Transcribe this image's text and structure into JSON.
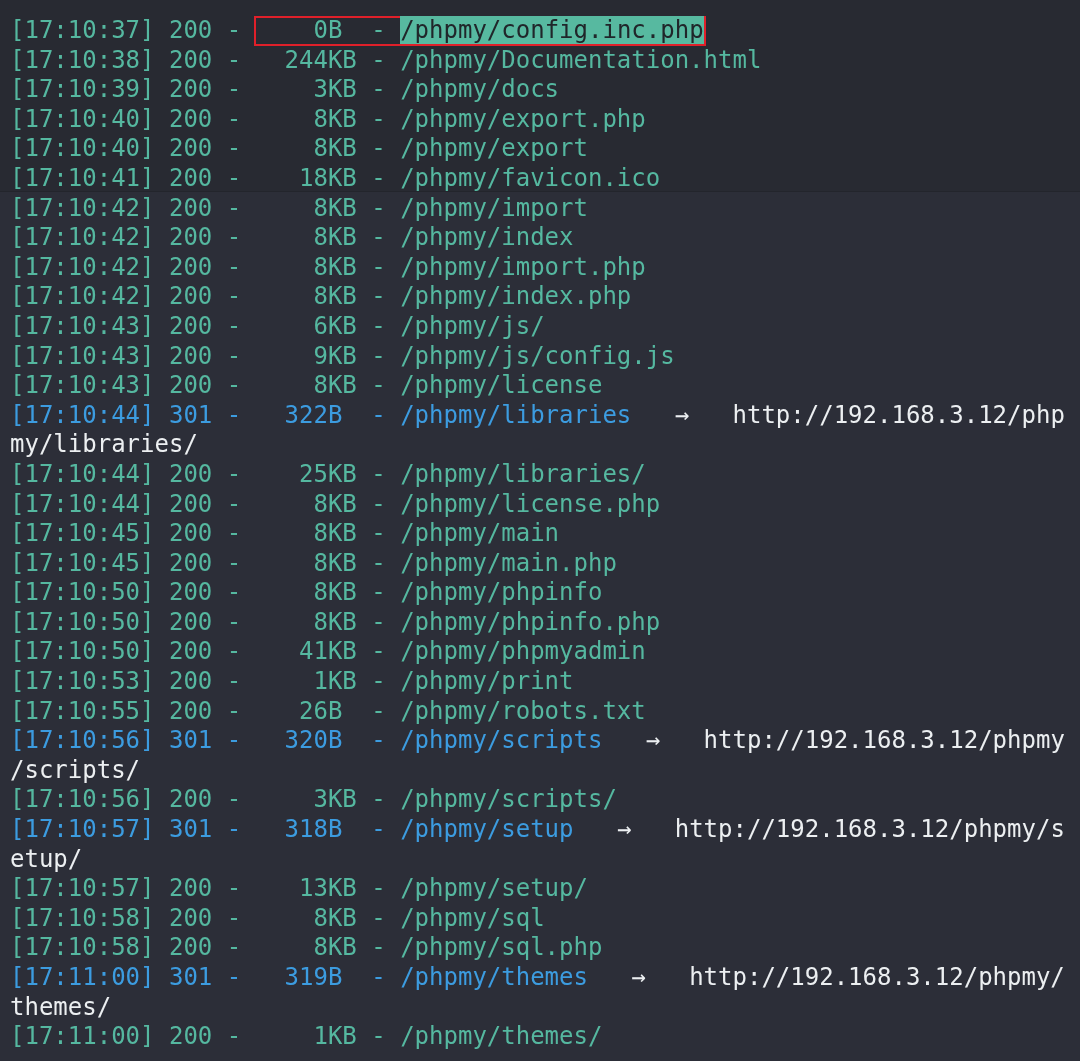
{
  "terminal": {
    "lines": [
      {
        "kind": "ok",
        "text": "[17:10:37] 200 - ",
        "marked": {
          "text": "    0B  - ",
          "selection": "/phpmy/config.inc.php"
        }
      },
      {
        "kind": "ok",
        "text": "[17:10:38] 200 -   244KB - /phpmy/Documentation.html"
      },
      {
        "kind": "ok",
        "text": "[17:10:39] 200 -     3KB - /phpmy/docs"
      },
      {
        "kind": "ok",
        "text": "[17:10:40] 200 -     8KB - /phpmy/export.php"
      },
      {
        "kind": "ok",
        "text": "[17:10:40] 200 -     8KB - /phpmy/export"
      },
      {
        "kind": "ok",
        "text": "[17:10:41] 200 -    18KB - /phpmy/favicon.ico"
      },
      {
        "kind": "ok",
        "text": "[17:10:42] 200 -     8KB - /phpmy/import"
      },
      {
        "kind": "ok",
        "text": "[17:10:42] 200 -     8KB - /phpmy/index"
      },
      {
        "kind": "ok",
        "text": "[17:10:42] 200 -     8KB - /phpmy/import.php"
      },
      {
        "kind": "ok",
        "text": "[17:10:42] 200 -     8KB - /phpmy/index.php"
      },
      {
        "kind": "ok",
        "text": "[17:10:43] 200 -     6KB - /phpmy/js/"
      },
      {
        "kind": "ok",
        "text": "[17:10:43] 200 -     9KB - /phpmy/js/config.js"
      },
      {
        "kind": "ok",
        "text": "[17:10:43] 200 -     8KB - /phpmy/license"
      },
      {
        "kind": "redirect",
        "text": "[17:10:44] 301 -   322B  - /phpmy/libraries",
        "arrow": "→",
        "url": "http://192.168.3.12/php"
      },
      {
        "kind": "wrap",
        "text": "my/libraries/"
      },
      {
        "kind": "ok",
        "text": "[17:10:44] 200 -    25KB - /phpmy/libraries/"
      },
      {
        "kind": "ok",
        "text": "[17:10:44] 200 -     8KB - /phpmy/license.php"
      },
      {
        "kind": "ok",
        "text": "[17:10:45] 200 -     8KB - /phpmy/main"
      },
      {
        "kind": "ok",
        "text": "[17:10:45] 200 -     8KB - /phpmy/main.php"
      },
      {
        "kind": "ok",
        "text": "[17:10:50] 200 -     8KB - /phpmy/phpinfo"
      },
      {
        "kind": "ok",
        "text": "[17:10:50] 200 -     8KB - /phpmy/phpinfo.php"
      },
      {
        "kind": "ok",
        "text": "[17:10:50] 200 -    41KB - /phpmy/phpmyadmin"
      },
      {
        "kind": "ok",
        "text": "[17:10:53] 200 -     1KB - /phpmy/print"
      },
      {
        "kind": "ok",
        "text": "[17:10:55] 200 -    26B  - /phpmy/robots.txt"
      },
      {
        "kind": "redirect",
        "text": "[17:10:56] 301 -   320B  - /phpmy/scripts",
        "arrow": "→",
        "url": "http://192.168.3.12/phpmy"
      },
      {
        "kind": "wrap",
        "text": "/scripts/"
      },
      {
        "kind": "ok",
        "text": "[17:10:56] 200 -     3KB - /phpmy/scripts/"
      },
      {
        "kind": "redirect",
        "text": "[17:10:57] 301 -   318B  - /phpmy/setup",
        "arrow": "→",
        "url": "http://192.168.3.12/phpmy/s"
      },
      {
        "kind": "wrap",
        "text": "etup/"
      },
      {
        "kind": "ok",
        "text": "[17:10:57] 200 -    13KB - /phpmy/setup/"
      },
      {
        "kind": "ok",
        "text": "[17:10:58] 200 -     8KB - /phpmy/sql"
      },
      {
        "kind": "ok",
        "text": "[17:10:58] 200 -     8KB - /phpmy/sql.php"
      },
      {
        "kind": "redirect",
        "text": "[17:11:00] 301 -   319B  - /phpmy/themes",
        "arrow": "→",
        "url": "http://192.168.3.12/phpmy/"
      },
      {
        "kind": "wrap",
        "text": "themes/"
      },
      {
        "kind": "ok",
        "text": "[17:11:00] 200 -     1KB - /phpmy/themes/"
      }
    ]
  }
}
